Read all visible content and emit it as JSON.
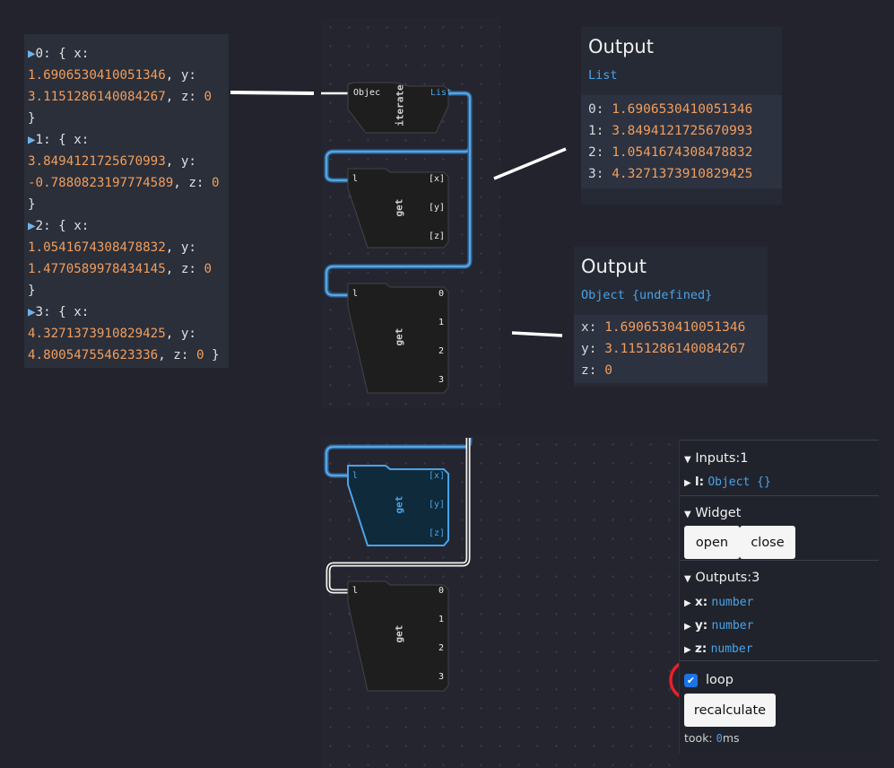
{
  "console": {
    "entries": [
      {
        "index": "0",
        "x": "1.6906530410051346",
        "y": "3.1151286140084267",
        "z": "0"
      },
      {
        "index": "1",
        "x": "3.8494121725670993",
        "y": "-0.7880823197774589",
        "z": "0"
      },
      {
        "index": "2",
        "x": "1.0541674308478832",
        "y": "1.4770589978434145",
        "z": "0"
      },
      {
        "index": "3",
        "x": "4.3271373910829425",
        "y": "4.800547554623336",
        "z": "0"
      }
    ]
  },
  "output_list": {
    "title": "Output",
    "type": "List",
    "rows": [
      {
        "key": "0",
        "value": "1.6906530410051346"
      },
      {
        "key": "1",
        "value": "3.8494121725670993"
      },
      {
        "key": "2",
        "value": "1.0541674308478832"
      },
      {
        "key": "3",
        "value": "4.3271373910829425"
      }
    ]
  },
  "output_object": {
    "title": "Output",
    "type": "Object {undefined}",
    "rows": [
      {
        "key": "x",
        "value": "1.6906530410051346"
      },
      {
        "key": "y",
        "value": "3.1151286140084267"
      },
      {
        "key": "z",
        "value": "0"
      }
    ]
  },
  "nodes": {
    "iterate": {
      "label": "iterate",
      "input": "Objec",
      "output": "List"
    },
    "get_xyz_1": {
      "label": "get",
      "input": "l",
      "outputs": [
        "[x]",
        "[y]",
        "[z]"
      ]
    },
    "get_num_1": {
      "label": "get",
      "input": "l",
      "outputs": [
        "0",
        "1",
        "2",
        "3"
      ]
    },
    "get_xyz_2": {
      "label": "get",
      "input": "l",
      "outputs": [
        "[x]",
        "[y]",
        "[z]"
      ]
    },
    "get_num_2": {
      "label": "get",
      "input": "l",
      "outputs": [
        "0",
        "1",
        "2",
        "3"
      ]
    }
  },
  "panel": {
    "inputs_header": "Inputs:1",
    "input_l_key": "l:",
    "input_l_value": "Object {}",
    "widget_header": "Widget",
    "open_label": "open",
    "close_label": "close",
    "outputs_header": "Outputs:3",
    "outputs": [
      {
        "key": "x:",
        "type": "number"
      },
      {
        "key": "y:",
        "type": "number"
      },
      {
        "key": "z:",
        "type": "number"
      }
    ],
    "loop_label": "loop",
    "loop_checked": true,
    "recalculate_label": "recalculate",
    "took_label": "took:",
    "took_value": "0",
    "took_unit": "ms"
  },
  "colors": {
    "accent": "#4aa3e8",
    "number": "#f29d5c",
    "highlight_circle": "#e8202a",
    "checkbox": "#1a73e8"
  }
}
